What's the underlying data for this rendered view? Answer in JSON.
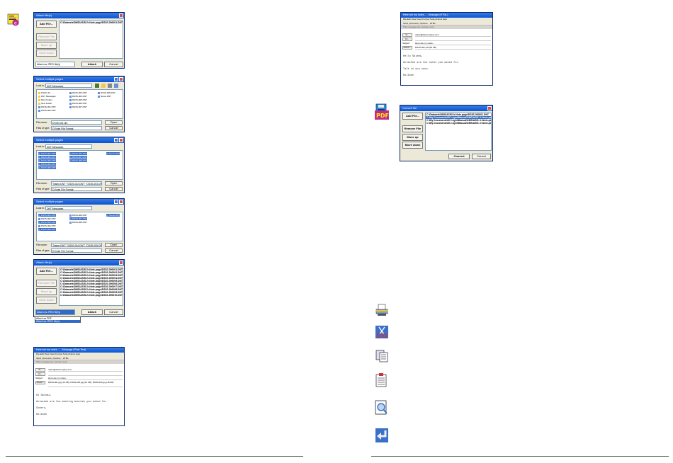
{
  "attach_dialog_1": {
    "title": "Attach file(s)",
    "buttons": [
      "Add File...",
      "Remove File",
      "Move up",
      "Move down"
    ],
    "files": [
      "C:\\Datasets\\DMS\\ASIS\\Jr-Note-page\\DS3S-000001.DNT"
    ],
    "filter": "Attach as JPEG file(s)",
    "attach": "Attach",
    "cancel": "Cancel"
  },
  "select_dialogs": [
    {
      "title": "Select multiple pages",
      "lookin_label": "Look in:",
      "lookin_value": "DNT Messages",
      "filename_label": "File name:",
      "filename_value": "DS3S-001.dnt",
      "filetype_label": "Files of type:",
      "filetype_value": "Di Note File Format",
      "open": "Open",
      "cancel": "Cancel"
    },
    {
      "title": "Select multiple pages",
      "lookin_label": "Look in:",
      "lookin_value": "DNT Messages",
      "filename_label": "File name:",
      "filename_value": "\"Name.DNT\" \"DS3S-002.DNT\" \"DS3S-003.DNT\"",
      "filetype_label": "Files of type:",
      "filetype_value": "Di Note File Format",
      "open": "Open",
      "cancel": "Cancel"
    },
    {
      "title": "Select multiple pages",
      "lookin_label": "Look in:",
      "lookin_value": "DNT Messages",
      "filename_label": "File name:",
      "filename_value": "\"Name.DNT\" \"DS3S-004.DNT\" \"DS3S-005.DNT\"",
      "filetype_label": "Files of type:",
      "filetype_value": "Di Note File Format",
      "open": "Open",
      "cancel": "Cancel"
    }
  ],
  "file_items": [
    "Public.dnt",
    "DNT Messages",
    "Mein Folder",
    "New Folder",
    "DS3S-001.DNT",
    "DS3S-002.DNT",
    "DS3S-003.DNT",
    "DS3S-004.DNT",
    "DS3S-005.DNT",
    "DS3S-006.DNT",
    "DS3S-007.DNT",
    "DS3S-008.DNT",
    "Name.DNT"
  ],
  "attach_dialog_2": {
    "title": "Attach file(s)",
    "buttons": [
      "Add File...",
      "Remove File",
      "Move up",
      "Move down"
    ],
    "files": [
      "C:\\Datasets\\DMS\\ASIS\\Jr-Note-page\\DS3S-000001.DNT",
      "C:\\Datasets\\DMS\\ASIS\\Jr-Note-page\\DS3S-000002.DNT",
      "C:\\Datasets\\DMS\\ASIS\\Jr-Note-page\\DS3S-000003.DNT",
      "C:\\Datasets\\DMS\\ASIS\\Jr-Note-page\\DS3S-000004.DNT",
      "C:\\Datasets\\DMS\\ASIS\\Jr-Note-page\\DS3S-000005.DNT",
      "C:\\Datasets\\DMS\\ASIS\\Jr-Note-page\\DS3S-000006.DNT",
      "C:\\Datasets\\DMS\\ASIS\\Jr-Note-page\\DS3S-000007.DNT",
      "C:\\Datasets\\DMS\\ASIS\\Jr-Note-page\\DS3S-000008.DNT",
      "C:\\Datasets\\DMS\\ASIS\\Jr-Note-page\\DS3S-000009.DNT",
      "C:\\Datasets\\DMS\\ASIS\\Jr-Note-page\\DS3S-000010.DNT"
    ],
    "filter": "Attach as JPEG file(s)",
    "dropdown_options": [
      "Attach as PDF",
      "Attach as JPEG file(s)"
    ],
    "attach": "Attach",
    "cancel": "Cancel"
  },
  "mail_left": {
    "title": "Here are my notes ... - Message (Plain Text)",
    "menu": "File  Edit  View  Insert  Format  Tools  Actions  Help",
    "tools": "Send | Accounts  |  Options...  HTML",
    "info": "This message has not been sent.",
    "to_label": "To...",
    "to_value": "mikes@thecompany.com",
    "cc_label": "Cc...",
    "subject_label": "Subject:",
    "subject_value": "Here are my notes...",
    "attach_label": "Attach...",
    "attach_value": "DS3S-001.jpg (14 KB);  DS3S-002.jpg (14 KB);  DS3S-003.jpg (18 KB)",
    "body": [
      "Hi Salemi,",
      "Attached are the meeting minutes you asked for.",
      "Cheers,",
      "Kolibeh"
    ]
  },
  "mail_right": {
    "title": "Here are my notes... - Message (HTML)",
    "menu": "File  Edit  View  Insert  Format  Tools  Actions  Help",
    "tools": "Send | Accounts  |  Options...  HTML",
    "info": "This message has not been sent.",
    "to_label": "To...",
    "to_value": "mikes@thecompany.com",
    "cc_label": "Cc...",
    "subject_label": "Subject:",
    "subject_value": "Here are my notes...",
    "attach_label": "Attach...",
    "attach_value": "DS3S-001.pdf (59 KB)",
    "body": [
      "Hello Salemi,",
      "Attached are the notes you asked for.",
      "Talk to you soon.",
      "Kolibeh"
    ]
  },
  "convert_dialog": {
    "title": "Convert file",
    "buttons": [
      "Add File...",
      "Remove File",
      "Move up",
      "Move down"
    ],
    "files": [
      "C:\\Datasets\\DMS\\ASIS\\Jr-Note-page\\DS3S-000001.DNT",
      "C:\\My Documents\\DC Light\\Manual\\DMS\\ASIS Jr-Note-page",
      "C:\\My Documents\\DC Light\\Manual\\DMS\\ASIS Jr-Note-page",
      "C:\\My Documents\\DC Light\\Manual\\DMS\\ASIS Jr-Note-page"
    ],
    "convert": "Convert",
    "cancel": "Cancel"
  },
  "colors": {
    "title_bar": "#0a55d8",
    "selection": "#316ac5",
    "dialog_bg": "#ece9d8"
  },
  "icons": [
    "attach-email-icon",
    "convert-pdf-icon",
    "print-icon",
    "cut-icon",
    "copy-icon",
    "paste-icon",
    "preview-icon",
    "undo-icon"
  ]
}
